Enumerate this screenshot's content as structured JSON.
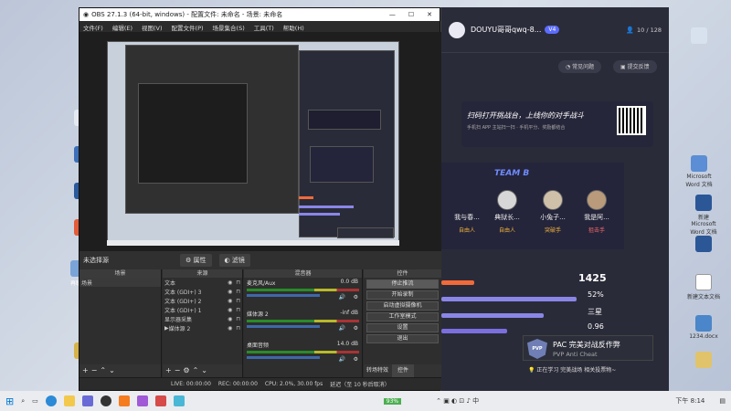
{
  "obs": {
    "title": "OBS 27.1.3 (64-bit, windows) - 配置文件: 未命名 - 场景: 未命名",
    "menu": [
      "文件(F)",
      "编辑(E)",
      "视图(V)",
      "配置文件(P)",
      "场景集合(S)",
      "工具(T)",
      "帮助(H)"
    ],
    "context_bar": {
      "no_source": "未选择源",
      "properties": "属性",
      "filters": "滤镜"
    },
    "docks": {
      "scenes": "场景",
      "sources": "来源",
      "mixer": "混音器",
      "controls": "控件"
    },
    "scene_item": "场景",
    "sources": [
      "文本",
      "文本 (GDI+) 3",
      "文本 (GDI+) 2",
      "文本 (GDI+) 1",
      "显示器采集",
      "媒体源 2"
    ],
    "mixer": [
      {
        "name": "麦克风/Aux",
        "level": "0.0 dB"
      },
      {
        "name": "媒体源 2",
        "level": "-inf dB"
      },
      {
        "name": "桌面音频",
        "level": "14.0 dB"
      }
    ],
    "controls": [
      "停止推流",
      "开始录制",
      "启动虚拟摄像机",
      "工作室模式",
      "设置",
      "退出"
    ],
    "controls_footer": {
      "transitions": "转场特效",
      "controls": "控件"
    },
    "status": {
      "live": "LIVE: 00:00:00",
      "rec": "REC: 00:00:00",
      "cpu": "CPU: 2.0%, 30.00 fps",
      "delay": "延迟（至 10 秒后取消）"
    }
  },
  "douyu": {
    "user": "DOUYU哥哥qwq-8...",
    "level_badge": "V4",
    "follow": "10 / 128",
    "btn_faq": "常见问题",
    "btn_feedback": "提交反馈",
    "promo_title": "扫码打开挑战台，上线你的对手战斗",
    "promo_sub": "手机扫 APP 主站扫一扫 · 手机平分、奖励都结合",
    "team": "TEAM B",
    "players": [
      {
        "name": "我与春...",
        "tag": "自由人"
      },
      {
        "name": "典狱长...",
        "tag": "自由人"
      },
      {
        "name": "小兔子...",
        "tag": "突破手"
      },
      {
        "name": "我是阿...",
        "tag": "狙击手"
      }
    ],
    "stats": [
      "1425",
      "52%",
      "三星",
      "0.96"
    ]
  },
  "pac": {
    "title": "PAC 完美对战反作弊",
    "sub": "PVP Anti Cheat",
    "notice": "正在学习 完美战场 相关投票物~"
  },
  "taskbar": {
    "time": "下午 8:14",
    "battery": "93%"
  },
  "desktop": {
    "icon_left": "再联系",
    "icon_r1": "Microsoft Word 文档",
    "icon_r2": "新建 Microsoft Word 文档",
    "icon_r3": "新建文本文档",
    "icon_r4": "1234.docx"
  }
}
